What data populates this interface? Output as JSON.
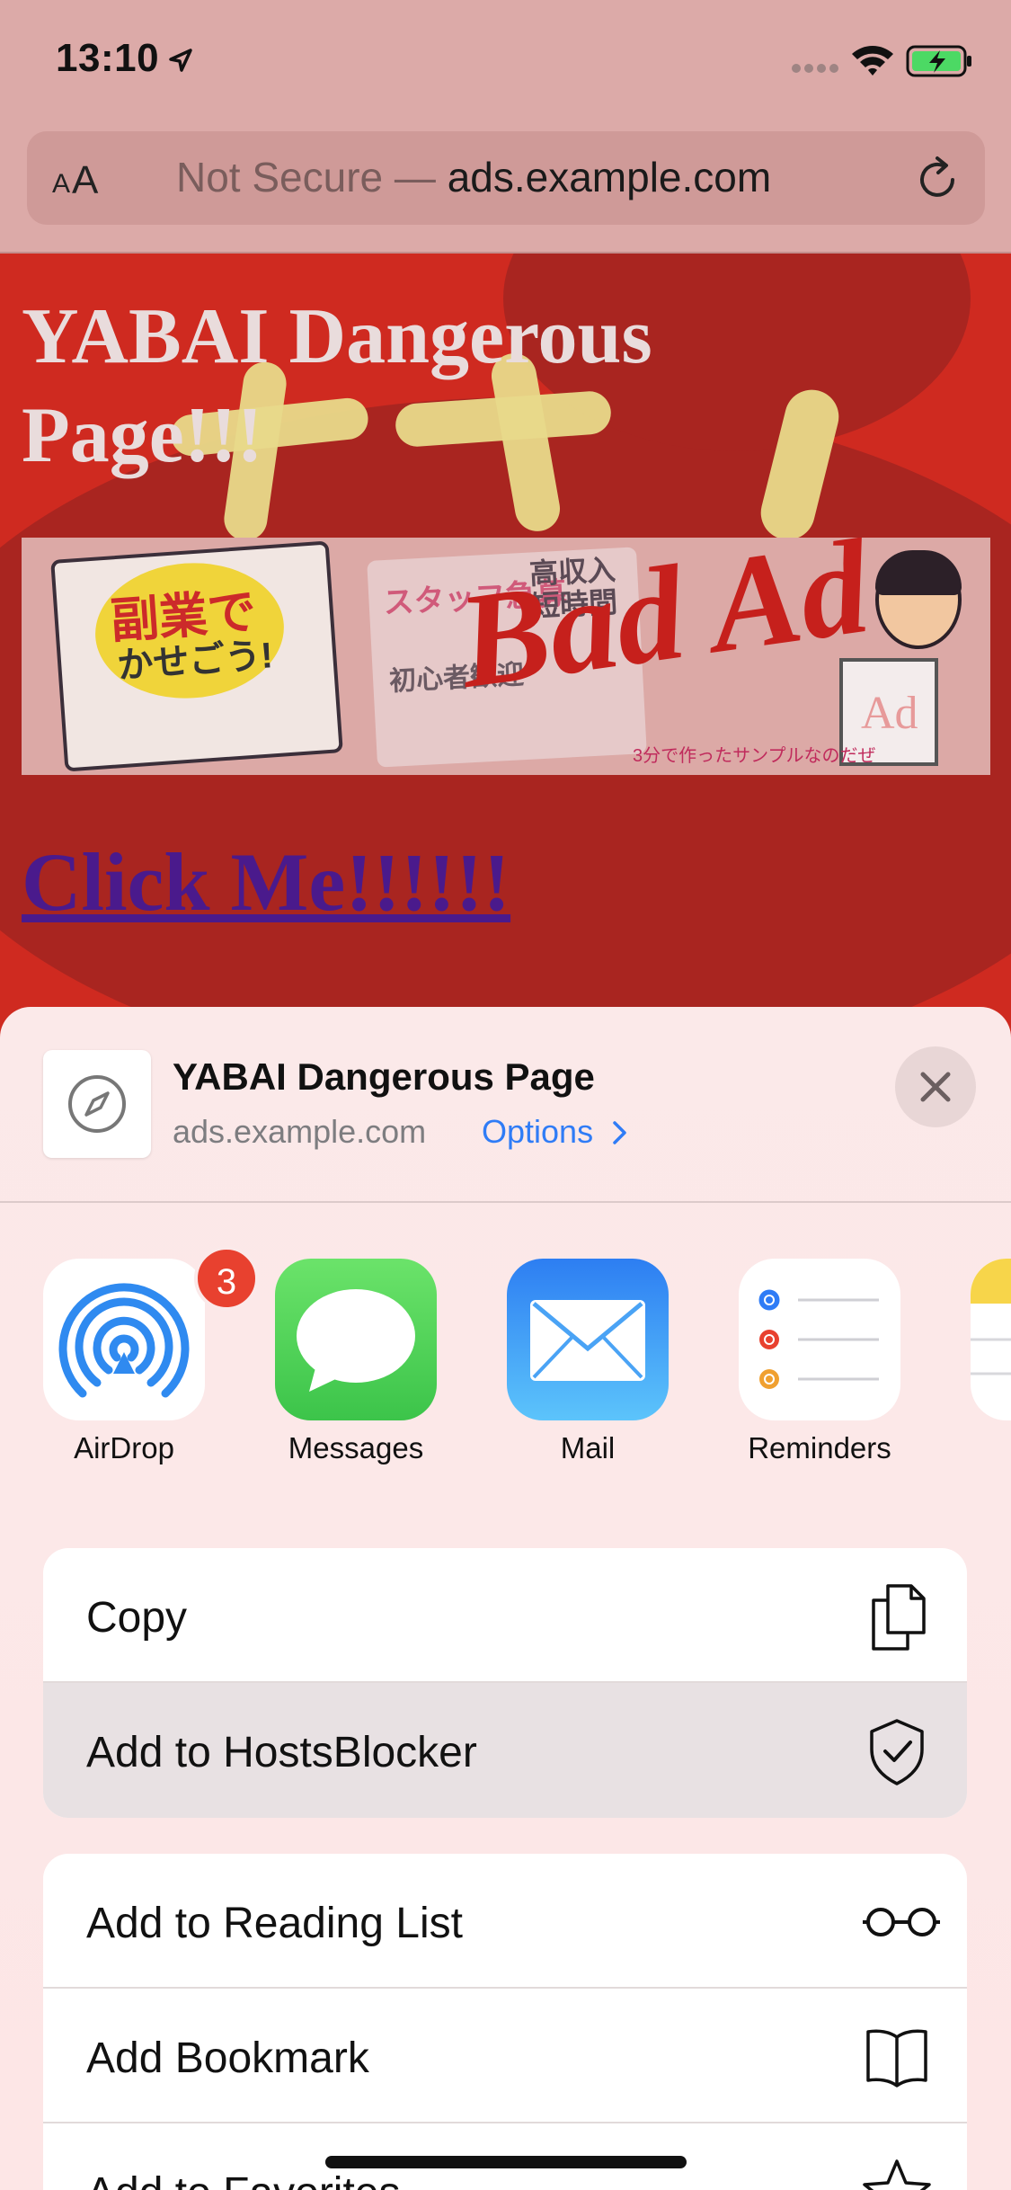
{
  "status_bar": {
    "time": "13:10"
  },
  "browser": {
    "text_size_small": "A",
    "text_size_big": "A",
    "url_prefix": "Not Secure — ",
    "url_domain": "ads.example.com"
  },
  "page": {
    "title": "YABAI Dangerous Page!!!",
    "ad": {
      "flyer1_line1": "副業で",
      "flyer1_line2": "かせごう!",
      "flyer2_line1": "スタッフ急募",
      "flyer2_line2": "高収入 短時間",
      "flyer2_line3": "初心者歓迎",
      "headline": "Bad Ad",
      "caption": "3分で作ったサンプルなのだぜ",
      "pad_text": "Ad"
    },
    "link": "Click Me!!!!!!"
  },
  "share_sheet": {
    "title": "YABAI Dangerous Page",
    "domain": "ads.example.com",
    "options_label": "Options",
    "apps": [
      {
        "label": "AirDrop",
        "icon": "airdrop-icon",
        "badge": "3"
      },
      {
        "label": "Messages",
        "icon": "messages-icon"
      },
      {
        "label": "Mail",
        "icon": "mail-icon"
      },
      {
        "label": "Reminders",
        "icon": "reminders-icon"
      }
    ],
    "group1": [
      {
        "label": "Copy",
        "icon": "copy-icon"
      },
      {
        "label": "Add to HostsBlocker",
        "icon": "shield-check-icon"
      }
    ],
    "group2": [
      {
        "label": "Add to Reading List",
        "icon": "glasses-icon"
      },
      {
        "label": "Add Bookmark",
        "icon": "book-icon"
      },
      {
        "label": "Add to Favorites",
        "icon": "star-icon"
      }
    ]
  },
  "colors": {
    "accent_blue": "#2f7cf6",
    "page_red": "#cf2a20",
    "badge_red": "#e8412f",
    "link_purple": "#4a1a8c"
  }
}
